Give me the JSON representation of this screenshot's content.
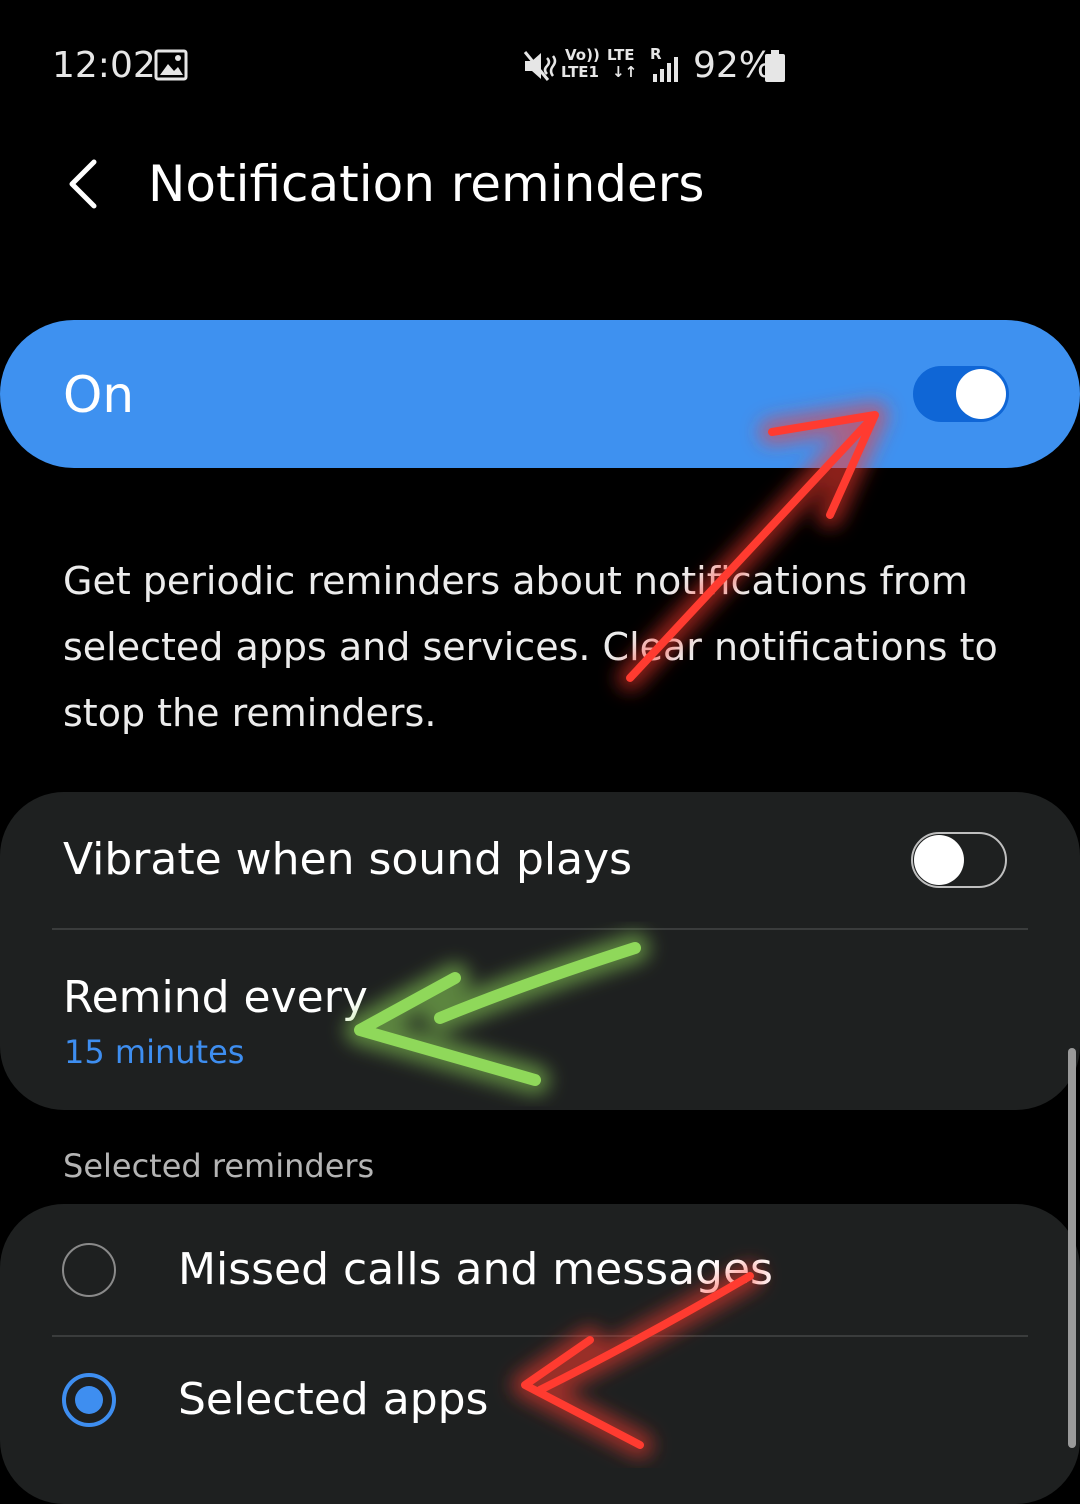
{
  "status_bar": {
    "time": "12:02",
    "volte_top": "Vo))",
    "volte_bottom": "LTE1",
    "lte_top": "LTE",
    "lte_arrows": "↓↑",
    "roaming": "R",
    "battery_percent": "92%",
    "icons": [
      "gallery-icon",
      "mute-icon",
      "signal-icon",
      "battery-icon"
    ]
  },
  "header": {
    "back_icon": "chevron-left-icon",
    "title": "Notification reminders"
  },
  "master_switch": {
    "label": "On",
    "on": true
  },
  "description": "Get periodic reminders about notifications from selected apps and services. Clear notifications to stop the reminders.",
  "settings": {
    "vibrate_label": "Vibrate when sound plays",
    "vibrate_on": false,
    "remind_label": "Remind every",
    "remind_value": "15 minutes"
  },
  "reminders": {
    "section_header": "Selected reminders",
    "options": [
      {
        "label": "Missed calls and messages",
        "selected": false
      },
      {
        "label": "Selected apps",
        "selected": true
      }
    ]
  },
  "colors": {
    "accent": "#3e91f0",
    "toggle_track_on": "#0f66d6",
    "card_background": "#1e2020",
    "link_blue": "#3e8ef0",
    "annotation_red": "#ff3b30",
    "annotation_green": "#8fd85a"
  }
}
